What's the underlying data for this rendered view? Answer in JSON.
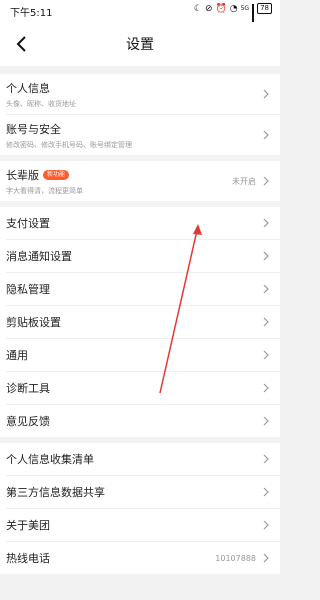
{
  "status_bar": {
    "time": "下午5:11",
    "network": "5G",
    "battery": "78"
  },
  "header": {
    "title": "设置",
    "back_icon": "chevron-left-icon"
  },
  "groups": [
    {
      "items": [
        {
          "label": "个人信息",
          "sub": "头像、昵称、收货地址"
        },
        {
          "label": "账号与安全",
          "sub": "修改密码、修改手机号码、账号绑定管理"
        }
      ]
    },
    {
      "items": [
        {
          "label": "长辈版",
          "badge": "新功能",
          "sub": "字大看得清，流程更简单",
          "value": "未开启"
        }
      ]
    },
    {
      "items": [
        {
          "label": "支付设置"
        },
        {
          "label": "消息通知设置"
        },
        {
          "label": "隐私管理"
        },
        {
          "label": "剪贴板设置"
        },
        {
          "label": "通用"
        },
        {
          "label": "诊断工具"
        },
        {
          "label": "意见反馈"
        }
      ]
    },
    {
      "items": [
        {
          "label": "个人信息收集清单"
        },
        {
          "label": "第三方信息数据共享"
        },
        {
          "label": "关于美团"
        },
        {
          "label": "热线电话",
          "value": "10107888"
        }
      ]
    }
  ],
  "annotation": {
    "color": "#e53935"
  },
  "colors": {
    "badge": "#ff5a2e",
    "background": "#f2f2f2"
  }
}
